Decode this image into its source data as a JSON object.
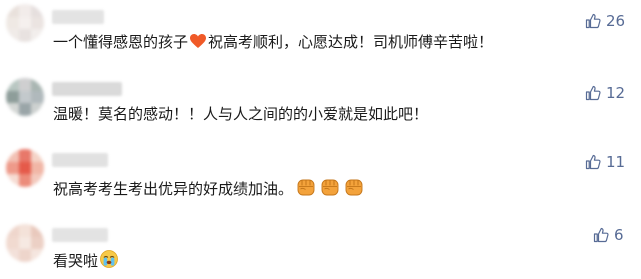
{
  "comments": [
    {
      "text_before": "一个懂得感恩的孩子",
      "emoji": "heart-icon",
      "text_after": "祝高考顺利，心愿达成！司机师傅辛苦啦！",
      "likes": "26"
    },
    {
      "text": "温暖！莫名的感动！！人与人之间的的小爱就是如此吧！",
      "likes": "12"
    },
    {
      "text": "祝高考考生考出优异的好成绩加油。",
      "emoji": "fist-icon",
      "emoji_count": 3,
      "likes": "11"
    },
    {
      "text": "看哭啦",
      "emoji": "crying-face-icon",
      "likes": "6"
    }
  ],
  "colors": {
    "like_blue": "#576b95",
    "text": "#1a1a1a",
    "heart": "#f05a28",
    "fist": "#f3a23b"
  }
}
